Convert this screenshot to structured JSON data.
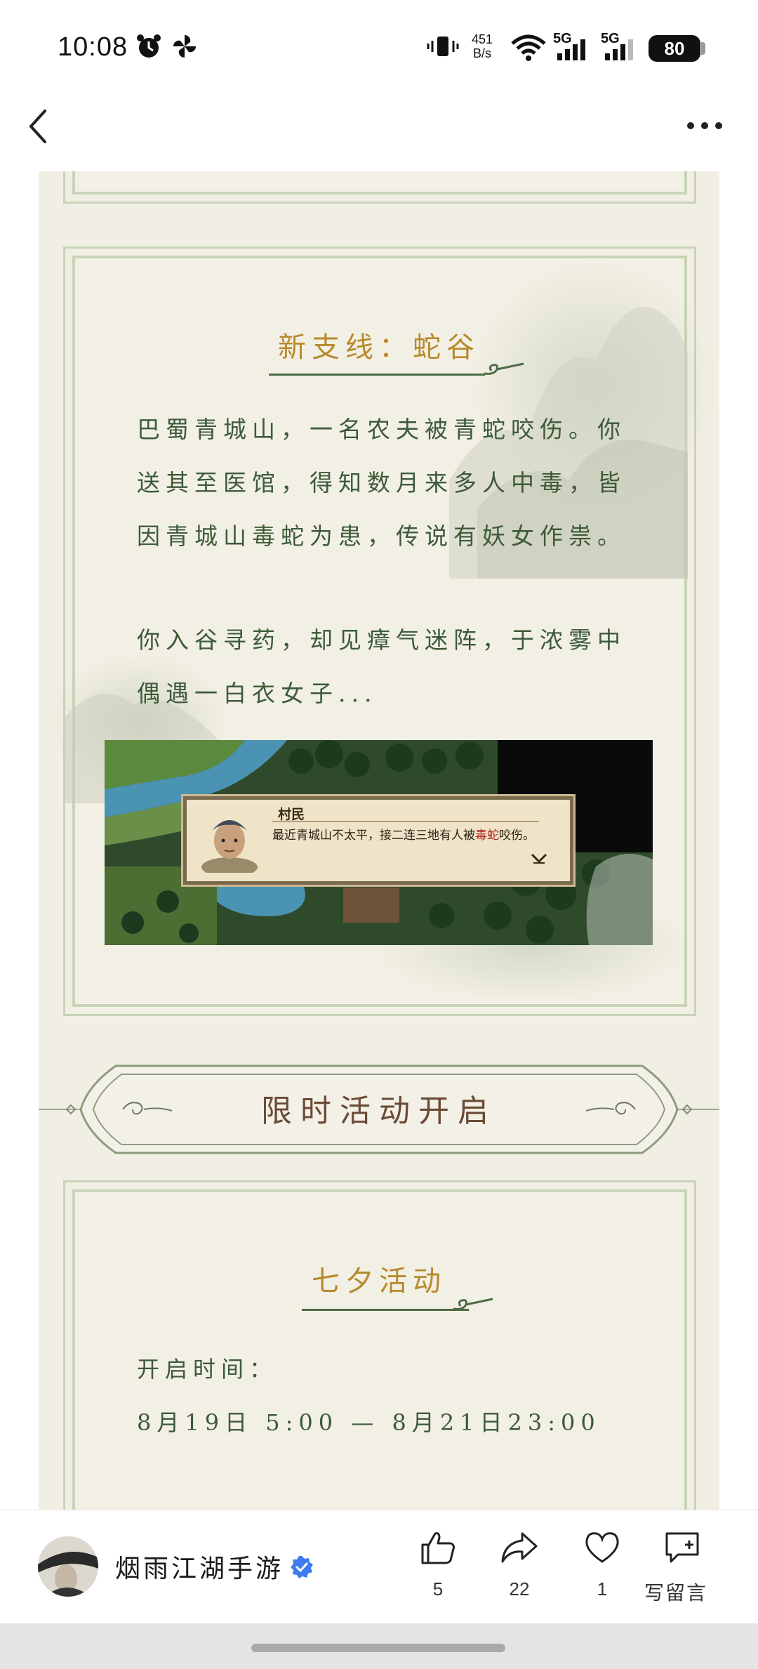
{
  "status_bar": {
    "time": "10:08",
    "net_speed_value": "451",
    "net_speed_unit": "B/s",
    "signal1_label": "5G",
    "signal2_label": "5G",
    "battery": "80"
  },
  "nav": {
    "back_icon": "chevron-left-icon",
    "more_icon": "more-horizontal-icon"
  },
  "section_snake": {
    "title": "新支线：蛇谷",
    "paragraph1": [
      "巴蜀青城山，一名农夫被青蛇咬伤。你",
      "送其至医馆，得知数月来多人中毒，皆",
      "因青城山毒蛇为患，传说有妖女作祟。"
    ],
    "paragraph2": [
      "你入谷寻药，却见瘴气迷阵，于浓雾中",
      "偶遇一白衣女子..."
    ],
    "game_dialog": {
      "speaker": "村民",
      "line_before": "最近青城山不太平，接二连三地有人被",
      "line_red": "毒蛇",
      "line_after": "咬伤。"
    }
  },
  "banner": {
    "title": "限时活动开启"
  },
  "section_qixi": {
    "title": "七夕活动",
    "time_label": "开启时间：",
    "time_range": "8月19日 5:00 — 8月21日23:00"
  },
  "bottom_bar": {
    "account_name": "烟雨江湖手游",
    "like_count": "5",
    "share_count": "22",
    "favorite_count": "1",
    "write_comment_label": "写留言"
  },
  "colors": {
    "paper": "#f1efe3",
    "frame": "#c9d3b7",
    "title_gold": "#b8892c",
    "body_green": "#3c5a39",
    "banner_brown": "#6b4a36",
    "verified_blue": "#3d7cf0"
  }
}
